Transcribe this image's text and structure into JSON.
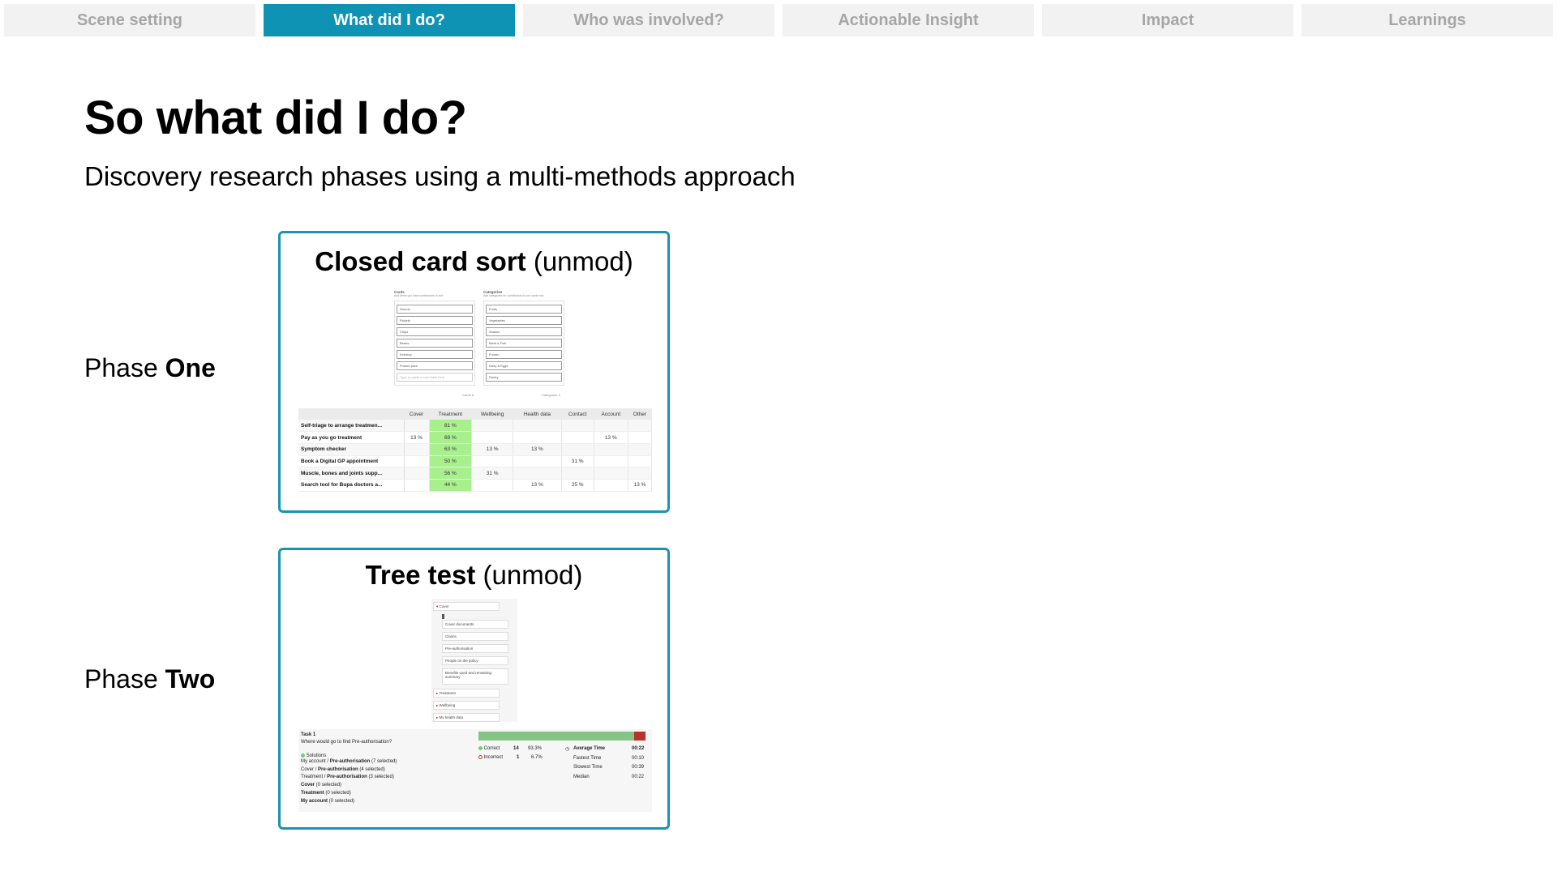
{
  "tabs": [
    {
      "label": "Scene setting",
      "active": false
    },
    {
      "label": "What did I do?",
      "active": true
    },
    {
      "label": "Who was involved?",
      "active": false
    },
    {
      "label": "Actionable Insight",
      "active": false
    },
    {
      "label": "Impact",
      "active": false
    },
    {
      "label": "Learnings",
      "active": false
    }
  ],
  "page_title": "So what did I do?",
  "subtitle": "Discovery research phases using a multi-methods approach",
  "phases": [
    {
      "prefix": "Phase ",
      "emph": "One"
    },
    {
      "prefix": "Phase ",
      "emph": "Two"
    }
  ],
  "card_sort": {
    "title_bold": "Closed card sort",
    "title_rest": " (unmod)",
    "cards_head": "Cards",
    "cards_sub": "Add items you want contributors to sort",
    "categories_head": "Categories",
    "categories_sub": "Add categories for contributors to sort cards into",
    "cards": [
      "Onions",
      "Pickels",
      "Chips",
      "Beans",
      "Ketchup",
      "Protein juice"
    ],
    "cards_placeholder": "Type or paste a card label here",
    "categories": [
      "Fruits",
      "Vegetables",
      "Snacks",
      "Meat & Fish",
      "Frozen",
      "Dairy & Eggs",
      "Pantry"
    ],
    "cards_count": "Cards 6",
    "categories_count": "Categories 4",
    "matrix_columns": [
      "",
      "Cover",
      "Treatment",
      "Wellbeing",
      "Health data",
      "Contact",
      "Account",
      "Other"
    ],
    "matrix_rows": [
      {
        "label": "Self-triage to arrange treatmen...",
        "cells": [
          "",
          "81 %",
          "",
          "",
          "",
          "",
          ""
        ]
      },
      {
        "label": "Pay as you go treatment",
        "cells": [
          "13 %",
          "69 %",
          "",
          "",
          "",
          "13 %",
          ""
        ]
      },
      {
        "label": "Symptom checker",
        "cells": [
          "",
          "63 %",
          "13 %",
          "13 %",
          "",
          "",
          ""
        ]
      },
      {
        "label": "Book a Digital GP appointment",
        "cells": [
          "",
          "50 %",
          "",
          "",
          "31 %",
          "",
          ""
        ]
      },
      {
        "label": "Muscle, bones and joints supp...",
        "cells": [
          "",
          "56 %",
          "31 %",
          "",
          "",
          "",
          ""
        ]
      },
      {
        "label": "Search tool for Bupa doctors a...",
        "cells": [
          "",
          "44 %",
          "",
          "13 %",
          "25 %",
          "",
          "13 %"
        ]
      }
    ]
  },
  "tree_test": {
    "title_bold": "Tree test",
    "title_rest": " (unmod)",
    "root": "Cover",
    "children": [
      "Cover documents",
      "Claims",
      "Pre-authorisation",
      "People on the policy",
      "Benefits used and remaining summary"
    ],
    "siblings": [
      "Treatment",
      "Wellbeing",
      "My health data"
    ],
    "task_title": "Task 1",
    "task_question": "Where would go to find Pre-authorisation?",
    "solutions_head": "Solutions",
    "solutions": [
      {
        "path": "My account / ",
        "bold": "Pre-authorisation",
        "count": " (7 selected)"
      },
      {
        "path": "Cover / ",
        "bold": "Pre-authorisation",
        "count": " (4 selected)"
      },
      {
        "path": "Treatment / ",
        "bold": "Pre-authorisation",
        "count": " (3 selected)"
      },
      {
        "path": "",
        "bold": "Cover",
        "count": " (0 selected)"
      },
      {
        "path": "",
        "bold": "Treatment",
        "count": " (0 selected)"
      },
      {
        "path": "",
        "bold": "My account",
        "count": " (0 selected)"
      }
    ],
    "correct_label": "Correct",
    "correct_count": "14",
    "correct_pct": "93.3%",
    "incorrect_label": "Incorrect",
    "incorrect_count": "1",
    "incorrect_pct": "6.7%",
    "correct_fraction": 0.933,
    "times": [
      {
        "label": "Average Time",
        "value": "00:22"
      },
      {
        "label": "Fastest Time",
        "value": "00:10"
      },
      {
        "label": "Slowest Time",
        "value": "00:39"
      },
      {
        "label": "Median",
        "value": "00:22"
      }
    ]
  },
  "colors": {
    "accent": "#0e93b4",
    "card_border": "#1a93b1",
    "highlight": "#a8ef8e",
    "correct": "#84c486",
    "incorrect": "#b6322a"
  }
}
